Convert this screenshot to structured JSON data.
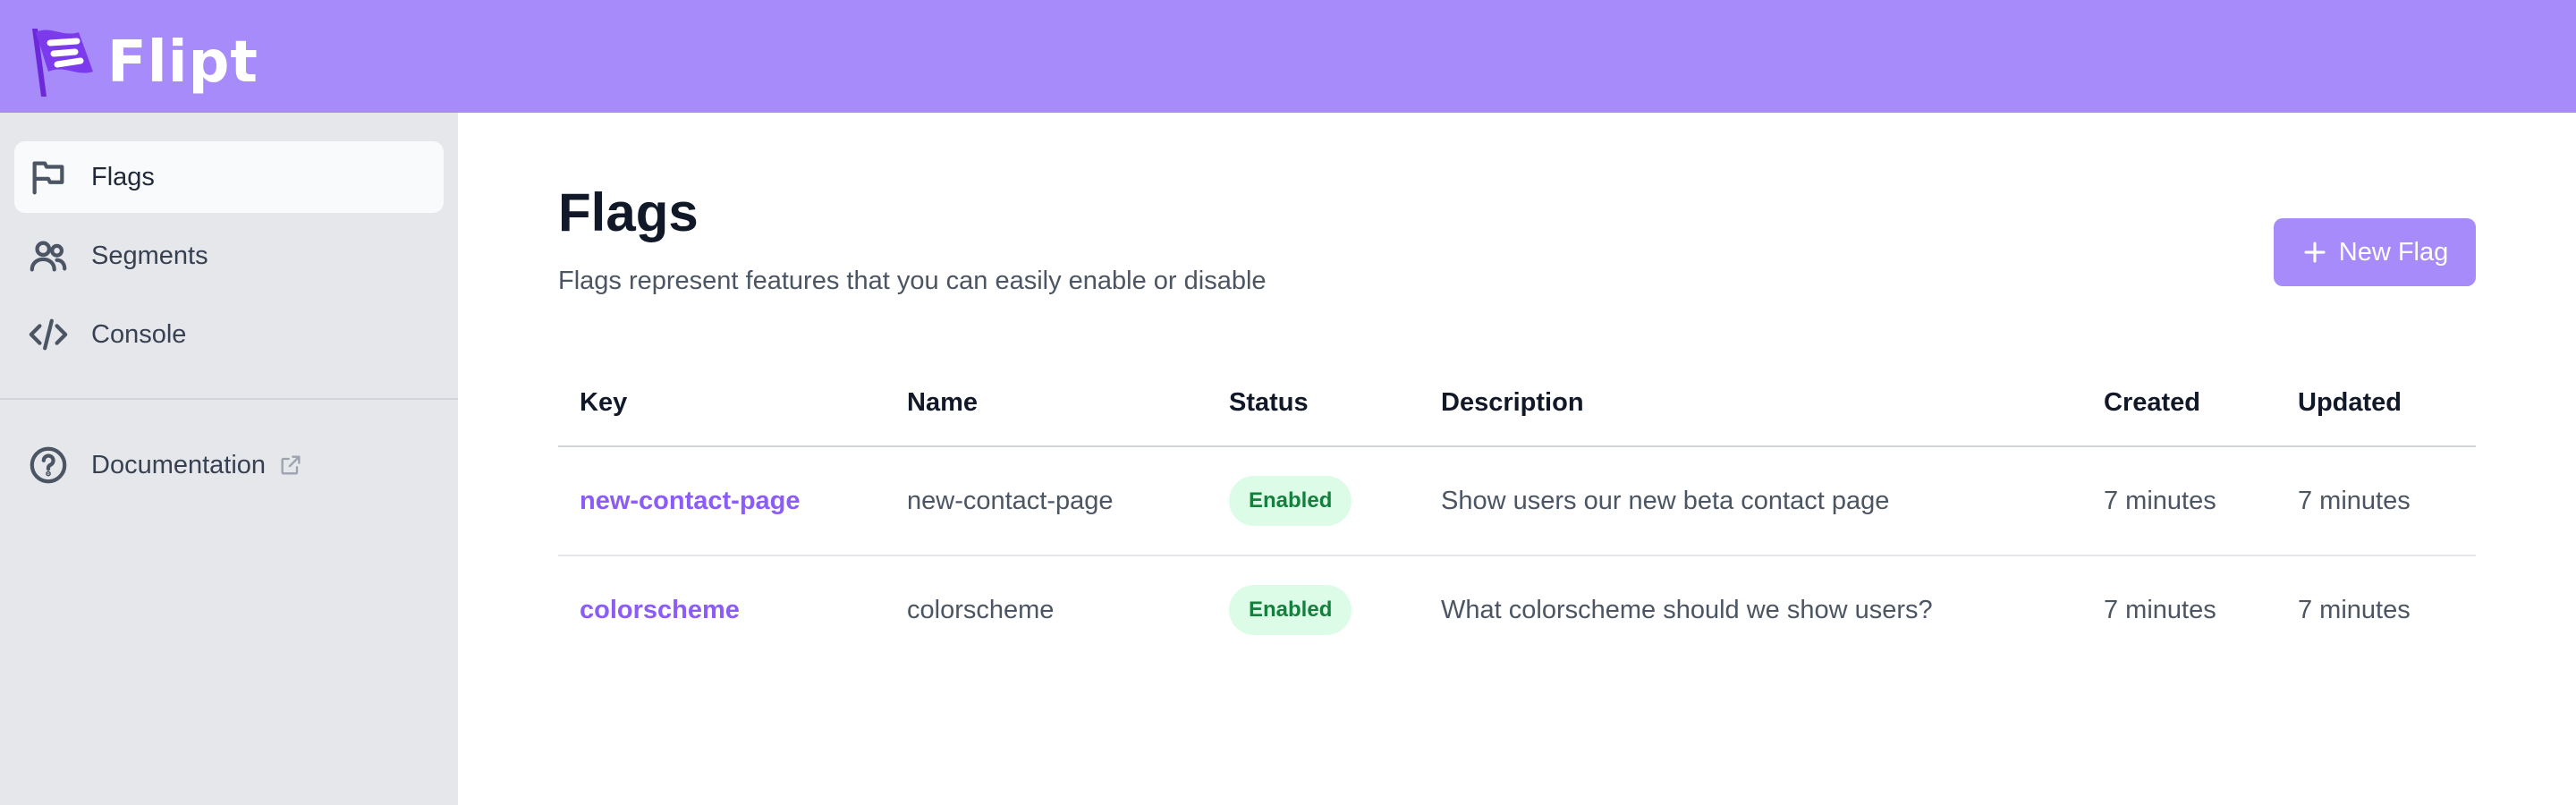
{
  "app": {
    "name": "Flipt",
    "brand_color": "#a78bfa"
  },
  "sidebar": {
    "items": [
      {
        "label": "Flags",
        "icon": "flag-icon",
        "active": true
      },
      {
        "label": "Segments",
        "icon": "users-icon",
        "active": false
      },
      {
        "label": "Console",
        "icon": "code-icon",
        "active": false
      }
    ],
    "footer_items": [
      {
        "label": "Documentation",
        "icon": "question-circle-icon",
        "external": true
      }
    ]
  },
  "main": {
    "title": "Flags",
    "subtitle": "Flags represent features that you can easily enable or disable",
    "new_button_label": "New Flag",
    "table": {
      "columns": [
        "Key",
        "Name",
        "Status",
        "Description",
        "Created",
        "Updated"
      ],
      "rows": [
        {
          "key": "new-contact-page",
          "name": "new-contact-page",
          "status": "Enabled",
          "description": "Show users our new beta contact page",
          "created": "7 minutes",
          "updated": "7 minutes"
        },
        {
          "key": "colorscheme",
          "name": "colorscheme",
          "status": "Enabled",
          "description": "What colorscheme should we show users?",
          "created": "7 minutes",
          "updated": "7 minutes"
        }
      ]
    }
  },
  "colors": {
    "accent": "#8b5cf6",
    "sidebar_bg": "#e5e7eb",
    "status_enabled_bg": "#dcfce7",
    "status_enabled_text": "#15803d"
  }
}
